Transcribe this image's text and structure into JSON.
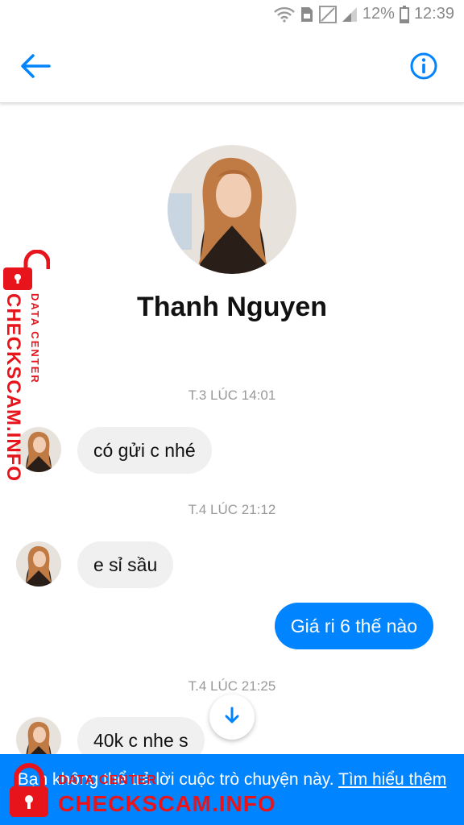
{
  "status_bar": {
    "battery": "12%",
    "time": "12:39"
  },
  "header": {
    "back_icon": "arrow-left-icon",
    "info_icon": "info-circle-icon",
    "accent_color": "#0084ff"
  },
  "profile": {
    "name": "Thanh Nguyen"
  },
  "conversation": [
    {
      "type": "timestamp",
      "text": "T.3 LÚC 14:01"
    },
    {
      "type": "incoming",
      "text": "có gửi c nhé"
    },
    {
      "type": "timestamp",
      "text": "T.4 LÚC 21:12"
    },
    {
      "type": "incoming",
      "text": "e sỉ sầu"
    },
    {
      "type": "outgoing",
      "text": "Giá ri 6 thế nào"
    },
    {
      "type": "timestamp",
      "text": "T.4 LÚC 21:25"
    },
    {
      "type": "incoming",
      "text": "40k c nhe s"
    }
  ],
  "footer": {
    "message": "Bạn không thể trả lời cuộc trò chuyện này.",
    "link": "Tìm hiểu thêm"
  },
  "watermark": {
    "main": "CHECKSCAM.INFO",
    "sub": "DATA CENTER"
  }
}
